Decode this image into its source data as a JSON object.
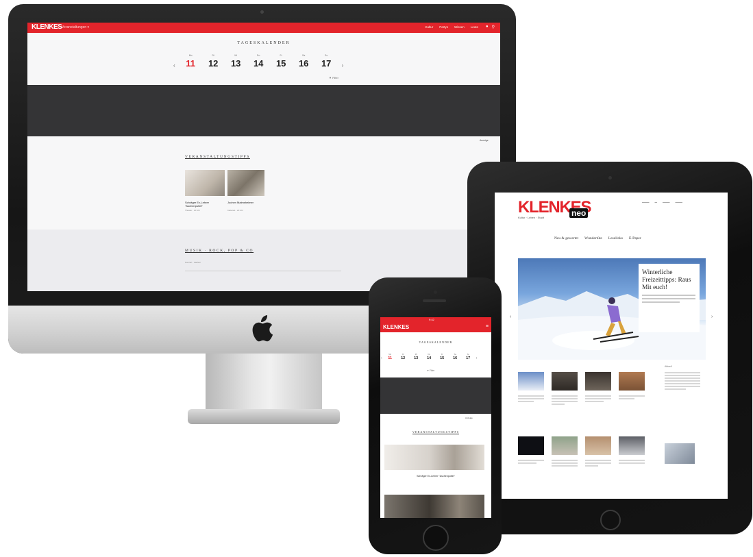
{
  "desktop": {
    "site_logo": "KLENKES",
    "dropdown": "Veranstaltungen ▾",
    "nav": [
      "Kultur",
      "Partys",
      "Wissen",
      "Leute"
    ],
    "calendar_title": "TAGESKALENDER",
    "days": [
      {
        "wd": "Mo",
        "num": "11",
        "active": true
      },
      {
        "wd": "Di",
        "num": "12"
      },
      {
        "wd": "Mi",
        "num": "13"
      },
      {
        "wd": "Do",
        "num": "14"
      },
      {
        "wd": "Fr",
        "num": "15"
      },
      {
        "wd": "Sa",
        "num": "16"
      },
      {
        "wd": "So",
        "num": "17"
      }
    ],
    "filter_label": "Filter",
    "ad_label": "Anzeige",
    "section_title": "VERANSTALTUNGSTIPPS",
    "cards": [
      {
        "title": "Schräger Ex-Lehrer \"Aschenputtel\"",
        "meta": "Theater · 20 Uhr"
      },
      {
        "title": "Jochen Malmsheimer",
        "meta": "Kabarett · 20 Uhr"
      }
    ],
    "section2_title": "MUSIK · ROCK, POP & CO",
    "section2_item": "Konzert · Aachen"
  },
  "tablet": {
    "logo": "KLENKES",
    "badge": "neo",
    "tagline": "Kultur · Leben · Stadt",
    "nav": [
      "Neu & gewertet",
      "Wundertüte",
      "Leselinks",
      "E-Paper"
    ],
    "hero_headline": "Winterliche Freizeittipps: Raus Mit euch!",
    "sidebar_title": "Aktuell"
  },
  "phone": {
    "time": "9:42",
    "logo": "KLENKES",
    "calendar_title": "TAGESKALENDER",
    "days": [
      {
        "wd": "Mo",
        "num": "11",
        "active": true
      },
      {
        "wd": "Di",
        "num": "12"
      },
      {
        "wd": "Mi",
        "num": "13"
      },
      {
        "wd": "Do",
        "num": "14"
      },
      {
        "wd": "Fr",
        "num": "15"
      },
      {
        "wd": "Sa",
        "num": "16"
      },
      {
        "wd": "So",
        "num": "17"
      }
    ],
    "filter_label": "Filter",
    "ad_label": "Anzeige",
    "section_title": "VERANSTALTUNGSTIPPS",
    "card_title": "Schräger Ex-Lehrer \"Aschenputtel\""
  },
  "colors": {
    "brand_red": "#e3242b",
    "dark_band": "#343436"
  }
}
